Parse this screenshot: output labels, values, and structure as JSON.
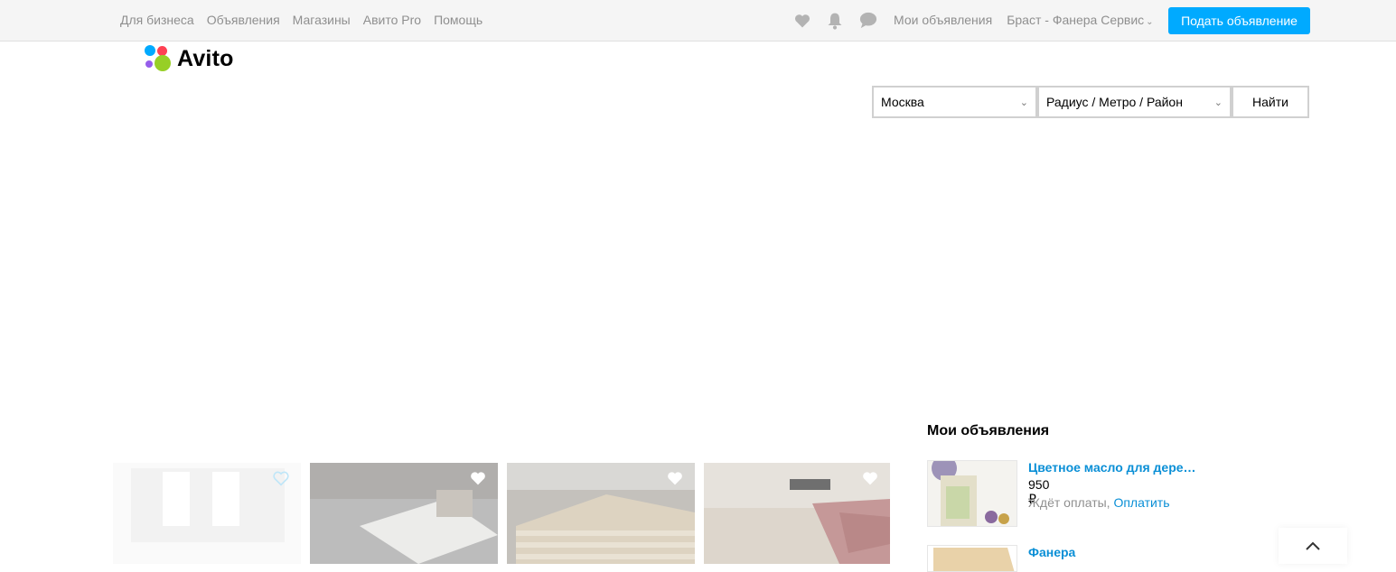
{
  "topnav": {
    "items": [
      "Для бизнеса",
      "Объявления",
      "Магазины",
      "Авито Pro",
      "Помощь"
    ]
  },
  "icons": [
    "heart-icon",
    "bell-icon",
    "chat-icon"
  ],
  "user_menu": {
    "my_ads": "Мои объявления",
    "account": "Браст - Фанера Сервис"
  },
  "post_button": "Подать объявление",
  "logo": {
    "text": "Avito"
  },
  "search": {
    "city": "Москва",
    "area": "Радиус / Метро / Район",
    "find": "Найти"
  },
  "right_panel": {
    "title": "Мои объявления",
    "ads": [
      {
        "title": "Цветное масло для дере…",
        "price": "950 ₽",
        "status": "Ждёт оплаты,",
        "action": "Оплатить"
      },
      {
        "title": "Фанера"
      }
    ]
  },
  "colors": {
    "accent": "#00aaff",
    "link": "#0a8fd6",
    "muted": "#8f8f8f"
  }
}
